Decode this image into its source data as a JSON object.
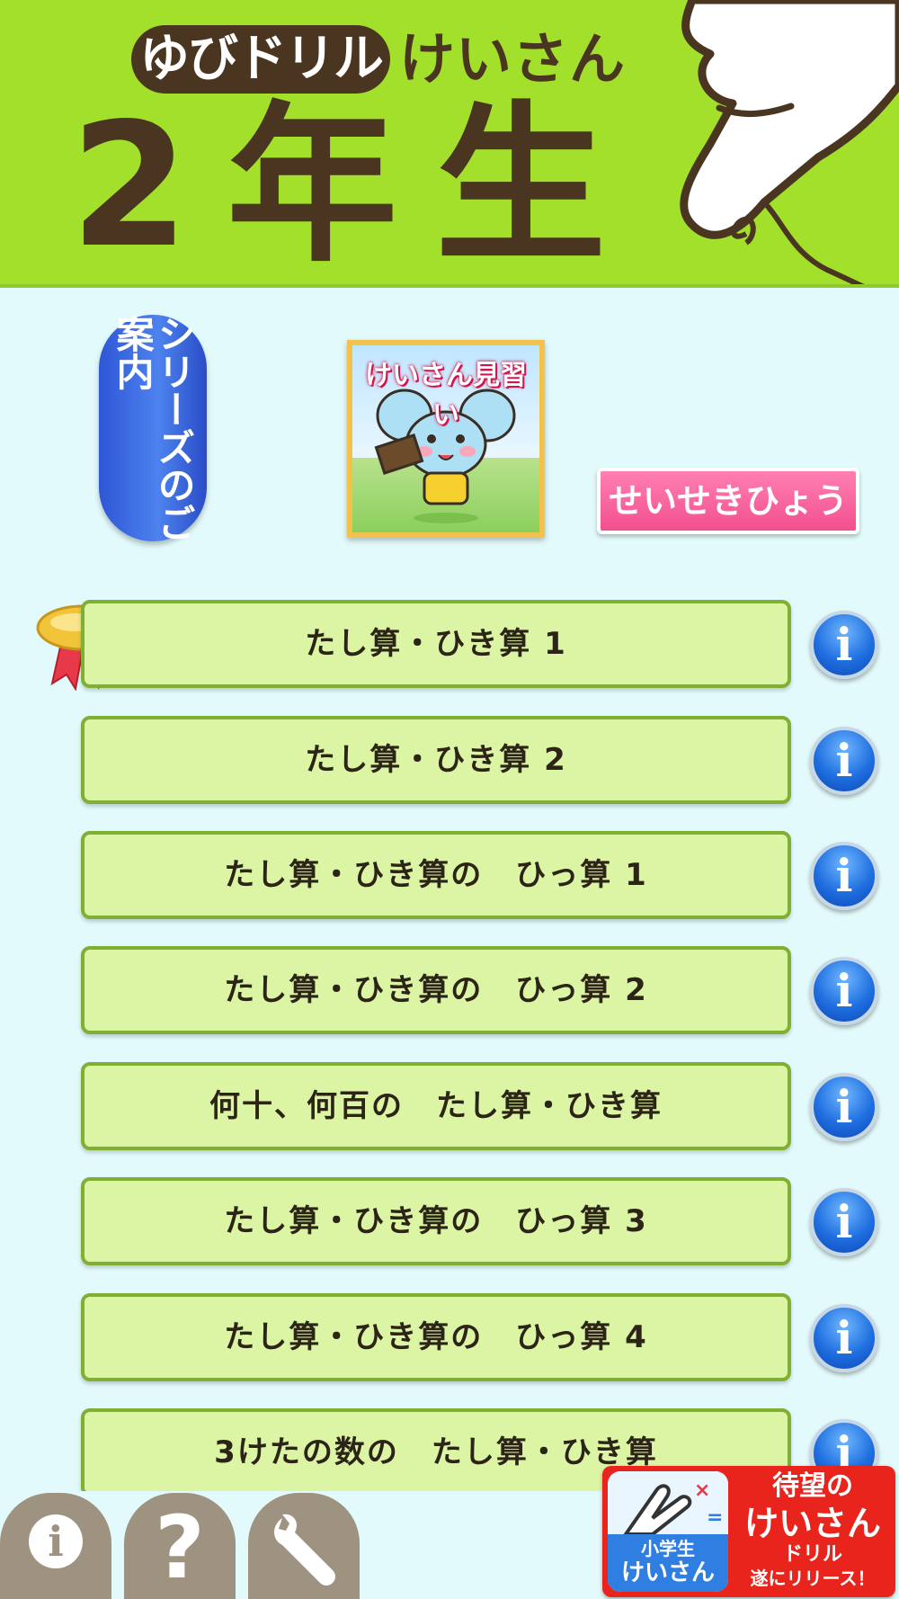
{
  "header": {
    "brand": "ゆびドリル",
    "subject": "けいさん",
    "grade": "2年生"
  },
  "controls": {
    "series_label": "シリーズのご案内",
    "promo_title": "けいさん見習い",
    "grades_label": "せいせきひょう"
  },
  "lessons": [
    {
      "label": "たし算・ひき算 1",
      "completed": true
    },
    {
      "label": "たし算・ひき算 2",
      "completed": false
    },
    {
      "label": "たし算・ひき算の　ひっ算 1",
      "completed": false
    },
    {
      "label": "たし算・ひき算の　ひっ算 2",
      "completed": false
    },
    {
      "label": "何十、何百の　たし算・ひき算",
      "completed": false
    },
    {
      "label": "たし算・ひき算の　ひっ算 3",
      "completed": false
    },
    {
      "label": "たし算・ひき算の　ひっ算 4",
      "completed": false
    },
    {
      "label": "3けたの数の　たし算・ひき算",
      "completed": false
    }
  ],
  "info_glyph": "i",
  "bottom_bar": {
    "info_glyph": "i",
    "help_glyph": "?"
  },
  "banner": {
    "app_label_line1": "小学生",
    "app_label_line2": "けいさん",
    "line1": "待望の",
    "line2": "けいさん",
    "line3": "ドリル",
    "line4": "遂にリリース！"
  },
  "colors": {
    "header_green": "#a3e02b",
    "brand_brown": "#4a3520",
    "lesson_fill": "#dcf5a4",
    "lesson_border": "#80b033",
    "background": "#e2fafb",
    "grades_pink": "#f2508f",
    "series_blue": "#2f56d6"
  }
}
